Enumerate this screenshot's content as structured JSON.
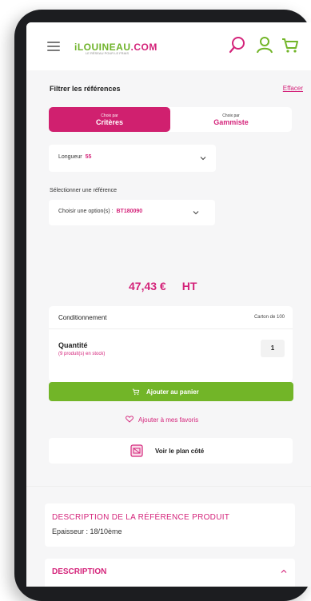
{
  "header": {
    "logo_text": "iLOUINEAU",
    "logo_suffix": ".COM",
    "logo_tagline": "LE RÉSEAU POUR LE FRAIS"
  },
  "filter": {
    "title": "Filtrer les références",
    "clear": "Effacer",
    "segment": {
      "active_small": "Choix par",
      "active_big": "Critères",
      "inactive_small": "Choix par",
      "inactive_big": "Gammiste"
    }
  },
  "length": {
    "label": "Longueur",
    "value": "55"
  },
  "reference": {
    "title": "Sélectionner une référence",
    "label": "Choisir une option(s) :",
    "value": "BT180090"
  },
  "price": {
    "amount": "47,43 €",
    "tax": "HT"
  },
  "packaging": {
    "label": "Conditionnement",
    "value": "Carton de 100"
  },
  "quantity": {
    "label": "Quantité",
    "stock": "(9 produit(s) en stock)",
    "value": "1"
  },
  "actions": {
    "add_to_cart": "Ajouter au panier",
    "add_favorite": "Ajouter à mes favoris",
    "view_plan": "Voir le plan côté"
  },
  "description_ref": {
    "title": "DESCRIPTION DE LA RÉFÉRENCE PRODUIT",
    "text": "Epaisseur : 18/10ème"
  },
  "description": {
    "title": "DESCRIPTION"
  },
  "colors": {
    "brand_pink": "#d4237a",
    "brand_green": "#72b528",
    "device_frame": "#1c1d20"
  },
  "icons": [
    "menu-icon",
    "search-icon",
    "user-icon",
    "cart-icon",
    "chevron-down-icon",
    "heart-icon",
    "plan-icon",
    "chevron-up-icon"
  ]
}
